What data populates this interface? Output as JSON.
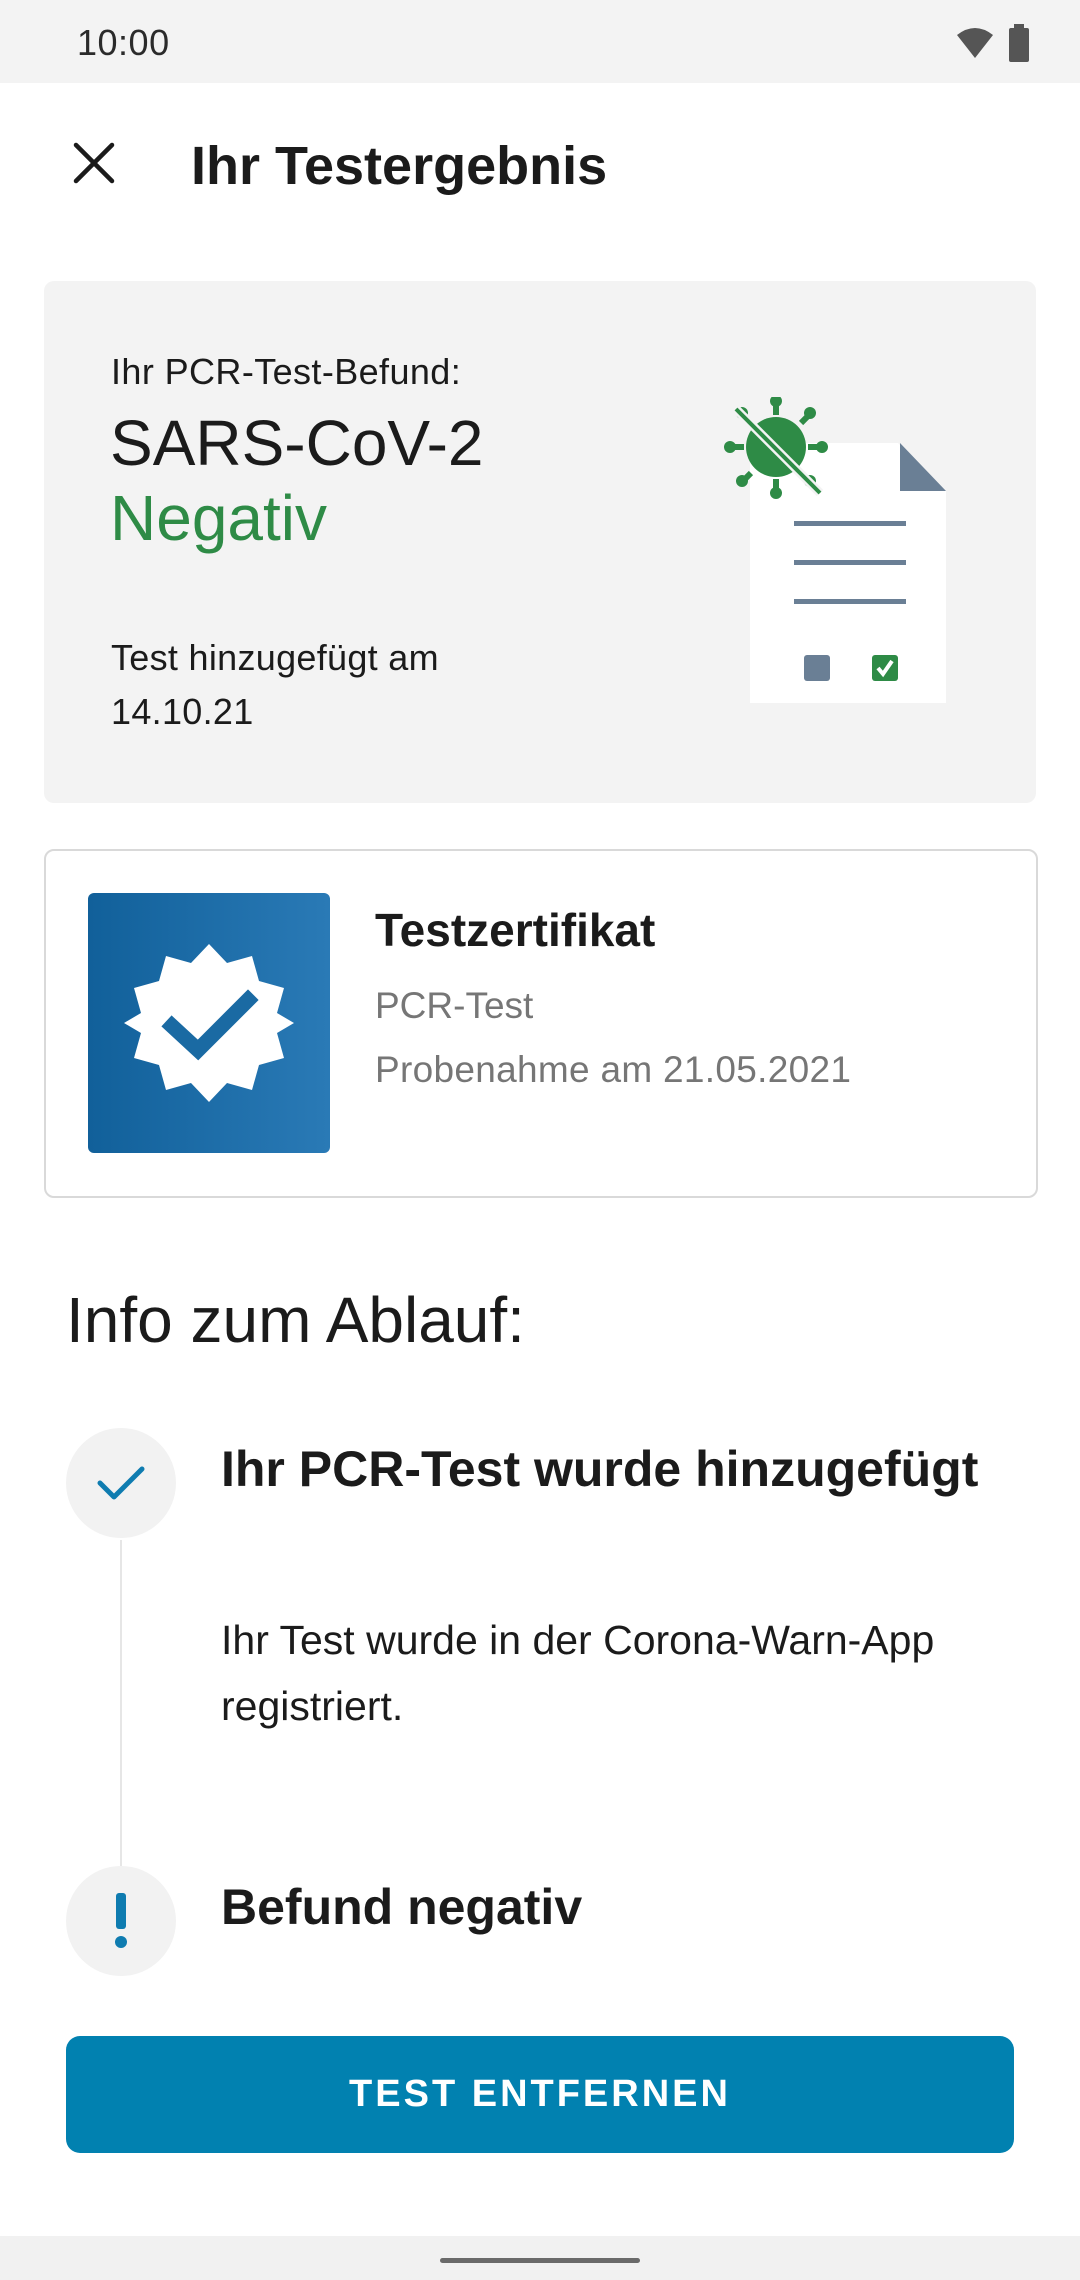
{
  "status_bar": {
    "time": "10:00",
    "icons": [
      "wifi-icon",
      "battery-icon"
    ]
  },
  "app_bar": {
    "title": "Ihr Testergebnis",
    "close_icon": "close-icon"
  },
  "result": {
    "label": "Ihr PCR-Test-Befund:",
    "virus": "SARS-CoV-2",
    "status": "Negativ",
    "added": "Test hinzugefügt am 14.10.21",
    "illustration": "document-virus-illustration",
    "colors": {
      "status": "#2e8b46",
      "background": "#f3f3f3"
    }
  },
  "certificate": {
    "title": "Testzertifikat",
    "type": "PCR-Test",
    "date": "Probenahme am 21.05.2021",
    "icon": "certificate-check-badge-icon"
  },
  "info": {
    "heading": "Info zum Ablauf:",
    "steps": [
      {
        "icon": "check-icon",
        "title": "Ihr PCR-Test wurde hinzugefügt",
        "body": "Ihr Test wurde in der Corona-Warn-App registriert."
      },
      {
        "icon": "exclamation-icon",
        "title": "Befund negativ"
      }
    ]
  },
  "actions": {
    "remove_label": "TEST ENTFERNEN",
    "color": "#0181b0"
  }
}
